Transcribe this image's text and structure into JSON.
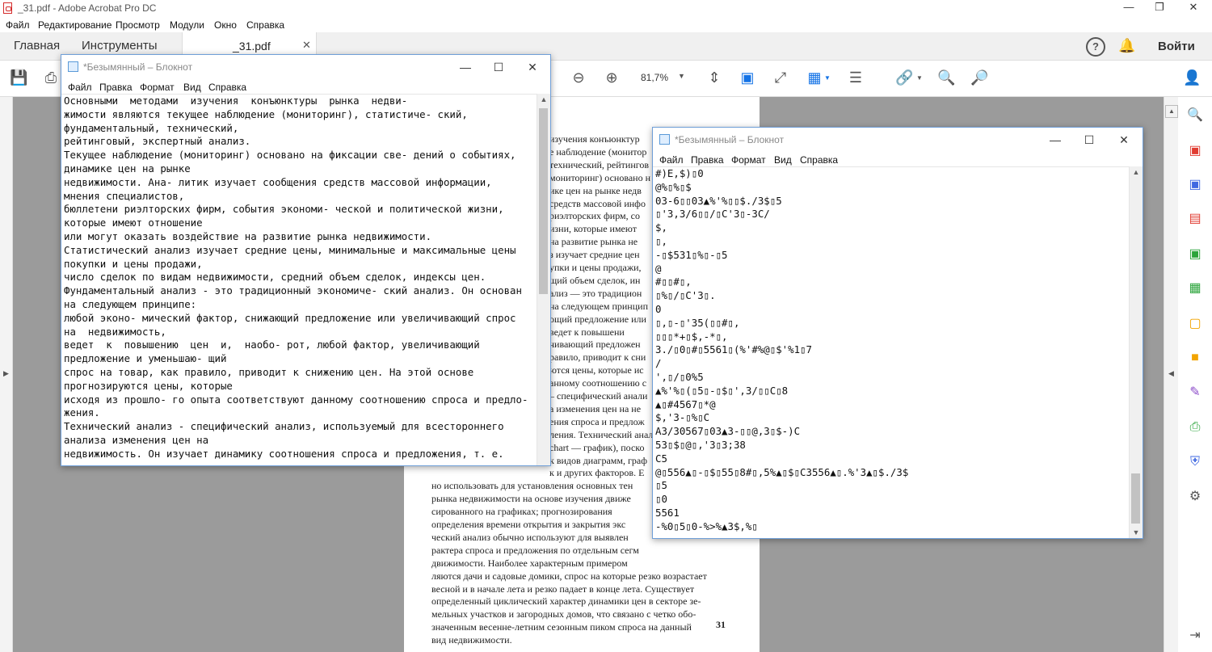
{
  "acrobat": {
    "title": "_31.pdf - Adobe Acrobat Pro DC",
    "menu": [
      "Файл",
      "Редактирование",
      "Просмотр",
      "Модули",
      "Окно",
      "Справка"
    ],
    "tabs": {
      "home": "Главная",
      "tools": "Инструменты",
      "doc": "_31.pdf",
      "signin": "Войти"
    },
    "zoom": "81,7%",
    "page_lines": [
      "изучения конъюнктур",
      "е наблюдение (монитор",
      "технический, рейтингов",
      "мониторинг) основано н",
      "ике цен на рынке недв",
      "средств массовой инфо",
      "риэлторских фирм, со",
      "изни, которые имеют",
      "на развитие рынка не",
      "з изучает средние цен",
      "упки и цены продажи,",
      "щий объем сделок, ин",
      "ализ — это традицион",
      "на следующем принцип",
      "ощий предложение или",
      "ведет к повышени",
      "чивающий предложен",
      "равило, приводит к сни",
      "ются цены, которые ис",
      "анному соотношению с",
      "– специфический анали",
      "а изменения цен на не",
      "ения спроса и предлож",
      "ления. Технический анал",
      "chart — график), поско",
      "к видов диаграмм, граф",
      "к и других факторов. Е",
      "но использовать для установления основных тен",
      "рынка недвижимости на основе изучения движе",
      "сированного на графиках; прогнозирования",
      "определения времени открытия и закрытия экс",
      "ческий анализ обычно используют для выявлен",
      "рактера спроса и предложения по отдельным сегм",
      "движимости. Наиболее характерным примером",
      "ляются дачи и садовые домики, спрос на которые резко возрастает",
      "весной и в начале лета и резко падает в конце лета. Существует",
      "определенный циклический характер динамики цен в секторе зе-",
      "мельных участков и загородных домов, что связано с четко обо-",
      "значенным весенне-летним сезонным пиком спроса на данный",
      "вид недвижимости."
    ],
    "page_number": "31"
  },
  "notepad1": {
    "title": "*Безымянный – Блокнот",
    "menu": [
      "Файл",
      "Правка",
      "Формат",
      "Вид",
      "Справка"
    ],
    "lines": [
      "Основными  методами  изучения  конъюнктуры  рынка  недви-",
      "жимости являются текущее наблюдение (мониторинг), статистиче- ский,",
      "фундаментальный, технический,",
      "рейтинговый, экспертный анализ.",
      "Текущее наблюдение (мониторинг) основано на фиксации све- дений о событиях,",
      "динамике цен на рынке",
      "недвижимости. Ана- литик изучает сообщения средств массовой информации,",
      "мнения специалистов,",
      "бюллетени риэлторских фирм, события экономи- ческой и политической жизни,",
      "которые имеют отношение",
      "или могут оказать воздействие на развитие рынка недвижимости.",
      "Статистический анализ изучает средние цены, минимальные и максимальные цены",
      "покупки и цены продажи,",
      "число сделок по видам недвижимости, средний объем сделок, индексы цен.",
      "Фундаментальный анализ - это традиционный экономиче- ский анализ. Он основан",
      "на следующем принципе:",
      "любой эконо- мический фактор, снижающий предложение или увеличивающий спрос",
      "на  недвижимость,",
      "ведет  к  повышению  цен  и,  наобо- рот, любой фактор, увеличивающий",
      "предложение и уменьшаю- щий",
      "спрос на товар, как правило, приводит к снижению цен. На этой основе",
      "прогнозируются цены, которые",
      "исходя из прошло- го опыта соответствуют данному соотношению спроса и предло-",
      "жения.",
      "Технический анализ - специфический анализ, используемый для всестороннего",
      "анализа изменения цен на",
      "недвижимость. Он изучает динамику соотношения спроса и предложения, т. е."
    ]
  },
  "notepad2": {
    "title": "*Безымянный – Блокнот",
    "menu": [
      "Файл",
      "Правка",
      "Формат",
      "Вид",
      "Справка"
    ],
    "lines": [
      "#)E,$)▯0",
      "@%▯%▯$",
      "03-6▯▯03▲%'%▯▯$./3$▯5",
      "▯'3,3/6▯▯/▯C'3▯-3C/",
      "$,",
      "▯,",
      "-▯$531▯%▯-▯5",
      "@",
      "#▯▯#▯,",
      "▯%▯/▯C'3▯.",
      "0",
      "▯,▯-▯'35(▯▯#▯,",
      "▯▯▯*+▯$,-*▯,",
      "3./▯0▯#▯5561▯(%'#%@▯$'%1▯7",
      "/",
      "',▯/▯0%5",
      "▲%'%▯(▯5▯-▯$▯',3/▯▯C▯8",
      "▲▯#4567▯*@",
      "$,'3-▯%▯C",
      "A3/30567▯03▲3-▯▯@,3▯$-)C",
      "53▯$▯@▯,'3▯3;38",
      "C5",
      "@▯556▲▯-▯$▯55▯8#▯,5%▲▯$▯C3556▲▯.%'3▲▯$./3$",
      "▯5",
      "▯0",
      "5561",
      "-%0▯5▯0-%>%▲3$,%▯"
    ]
  }
}
